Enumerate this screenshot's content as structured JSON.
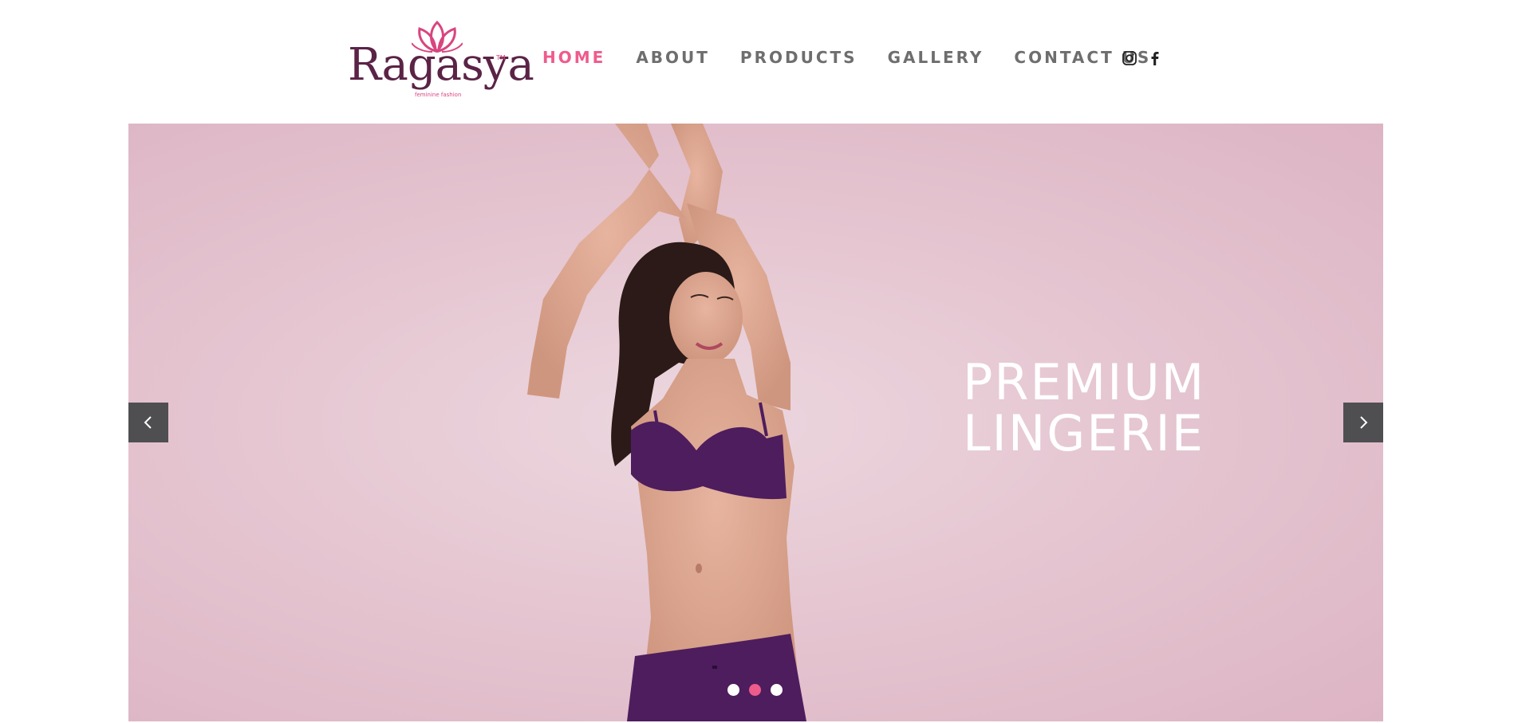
{
  "brand": {
    "name": "Ragasya",
    "trademark": "TM",
    "tagline": "feminine fashion"
  },
  "nav": {
    "items": [
      {
        "label": "HOME",
        "active": true
      },
      {
        "label": "ABOUT",
        "active": false
      },
      {
        "label": "PRODUCTS",
        "active": false
      },
      {
        "label": "GALLERY",
        "active": false
      },
      {
        "label": "CONTACT US",
        "active": false
      }
    ]
  },
  "socials": [
    "instagram-icon",
    "facebook-icon"
  ],
  "hero": {
    "headline_line1": "PREMIUM",
    "headline_line2": "LINGERIE",
    "slide_count": 3,
    "active_slide": 2
  },
  "colors": {
    "accent": "#ee5c8c",
    "nav_text": "#6e6e6e",
    "logo": "#5b2346",
    "hero_bg": "#e5c6d1",
    "garment": "#4e1d5e",
    "arrow_bg": "#4f4f52"
  }
}
